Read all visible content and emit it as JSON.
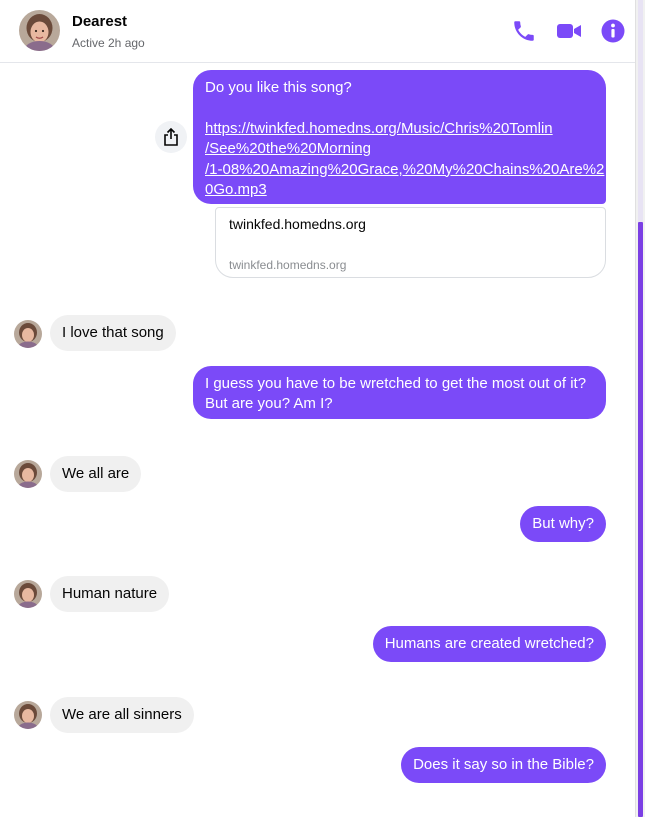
{
  "header": {
    "contact_name": "Dearest",
    "status": "Active 2h ago",
    "icons": [
      "phone-icon",
      "video-icon",
      "info-icon"
    ]
  },
  "colors": {
    "accent": "#7b4af8",
    "incoming_bubble": "#f0f0f0",
    "status_text": "#65676b"
  },
  "messages": {
    "m1": {
      "line1": "Do you like this song?",
      "link_lines": [
        "https://twinkfed.homedns.org/Music/Chris%20Tomlin",
        "/See%20the%20Morning",
        "/1-08%20Amazing%20Grace,%20My%20Chains%20Are%2",
        "0Go.mp3"
      ],
      "preview_title": "twinkfed.homedns.org",
      "preview_domain": "twinkfed.homedns.org"
    },
    "m2": "I love that song",
    "m3": {
      "line1": "I guess you have to be wretched to get the most out of it?",
      "line2": "But are you?  Am I?"
    },
    "m4": "We all are",
    "m5": "But why?",
    "m6": "Human nature",
    "m7": "Humans are created wretched?",
    "m8": "We are all sinners",
    "m9": "Does it say so in the Bible?"
  }
}
